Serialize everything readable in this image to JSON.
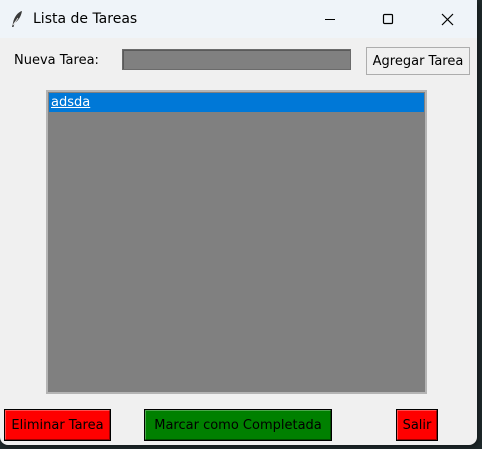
{
  "window": {
    "title": "Lista de Tareas",
    "app_icon": "feather-icon"
  },
  "window_controls": {
    "minimize_icon": "minimize-icon",
    "maximize_icon": "maximize-icon",
    "close_icon": "close-icon"
  },
  "form": {
    "label": "Nueva Tarea:",
    "input_value": "",
    "add_button": "Agregar Tarea"
  },
  "tasks": {
    "items": [
      {
        "text": "adsda",
        "selected": true
      }
    ]
  },
  "actions": {
    "delete_label": "Eliminar Tarea",
    "delete_color": "#ff0000",
    "complete_label": "Marcar como Completada",
    "complete_color": "#008000",
    "exit_label": "Salir",
    "exit_color": "#ff0000"
  },
  "colors": {
    "listbox_bg": "#808080",
    "selection": "#0078d7",
    "window_bg": "#f0f0f0"
  }
}
